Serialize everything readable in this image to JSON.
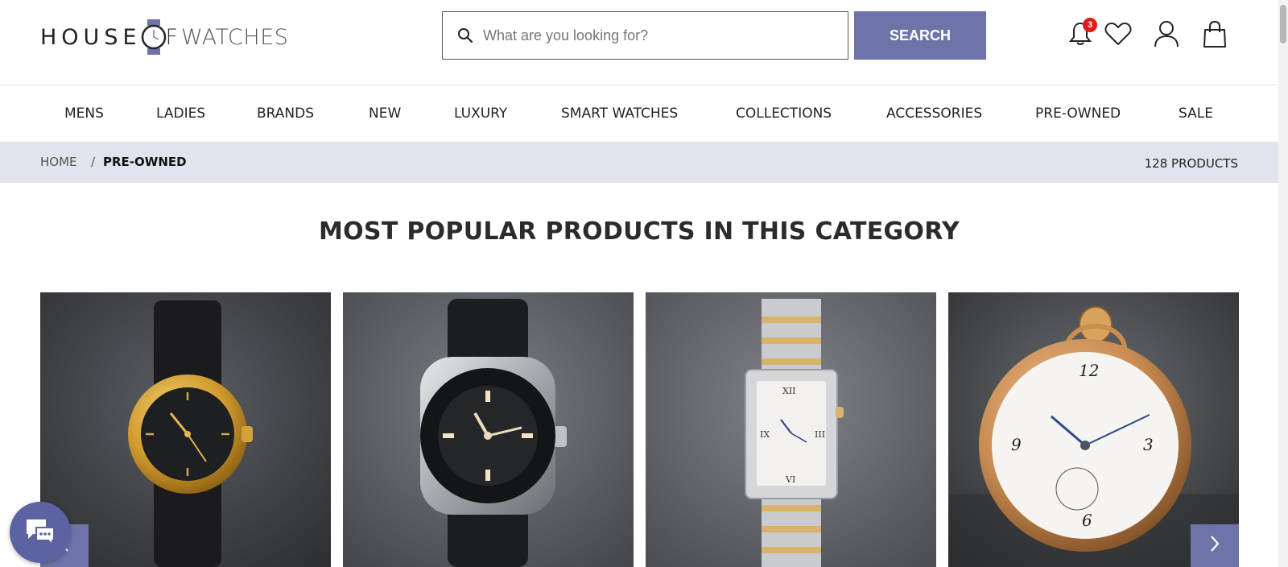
{
  "header": {
    "logo": {
      "house": "HOUSE",
      "o_f": "F",
      "watches": "WATCHES"
    },
    "search": {
      "placeholder": "What are you looking for?",
      "value": "",
      "button_label": "SEARCH"
    },
    "notifications": {
      "count": "3"
    },
    "icons": [
      "bell-icon",
      "heart-icon",
      "user-icon",
      "shopping-bag-icon"
    ]
  },
  "nav": {
    "items": [
      "MENS",
      "LADIES",
      "BRANDS",
      "NEW",
      "LUXURY",
      "SMART WATCHES",
      "COLLECTIONS",
      "ACCESSORIES",
      "PRE-OWNED",
      "SALE"
    ]
  },
  "breadcrumb": {
    "home": "HOME",
    "separator": "/",
    "current": "PRE-OWNED",
    "product_count": "128 PRODUCTS"
  },
  "section": {
    "title": "MOST POPULAR PRODUCTS IN THIS CATEGORY"
  },
  "products": [
    {
      "image": "gold-rolex-black-strap-watch"
    },
    {
      "image": "tudor-black-bay-steel-watch"
    },
    {
      "image": "cartier-tank-two-tone-watch"
    },
    {
      "image": "rose-gold-pocket-watch"
    }
  ],
  "colors": {
    "accent": "#6e74a8",
    "breadcrumb_bg": "#e1e4ec",
    "badge": "#e21b1b",
    "chat": "#5d63a2"
  }
}
